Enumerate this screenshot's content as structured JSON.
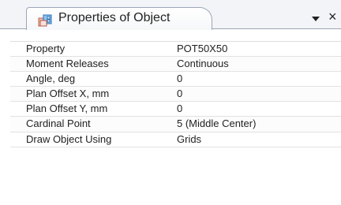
{
  "window": {
    "title": "Properties of Object",
    "icons": {
      "tab_icon": "properties-icon",
      "dropdown_icon": "dropdown-icon",
      "close_icon": "close-icon"
    }
  },
  "controls": {
    "close_symbol": "×"
  },
  "table": {
    "rows": [
      {
        "name": "Property",
        "value": "POT50X50"
      },
      {
        "name": "Moment Releases",
        "value": "Continuous"
      },
      {
        "name": "Angle, deg",
        "value": "0"
      },
      {
        "name": "Plan Offset X, mm",
        "value": "0"
      },
      {
        "name": "Plan Offset Y, mm",
        "value": "0"
      },
      {
        "name": "Cardinal Point",
        "value": "5 (Middle Center)"
      },
      {
        "name": "Draw Object Using",
        "value": "Grids"
      }
    ]
  }
}
